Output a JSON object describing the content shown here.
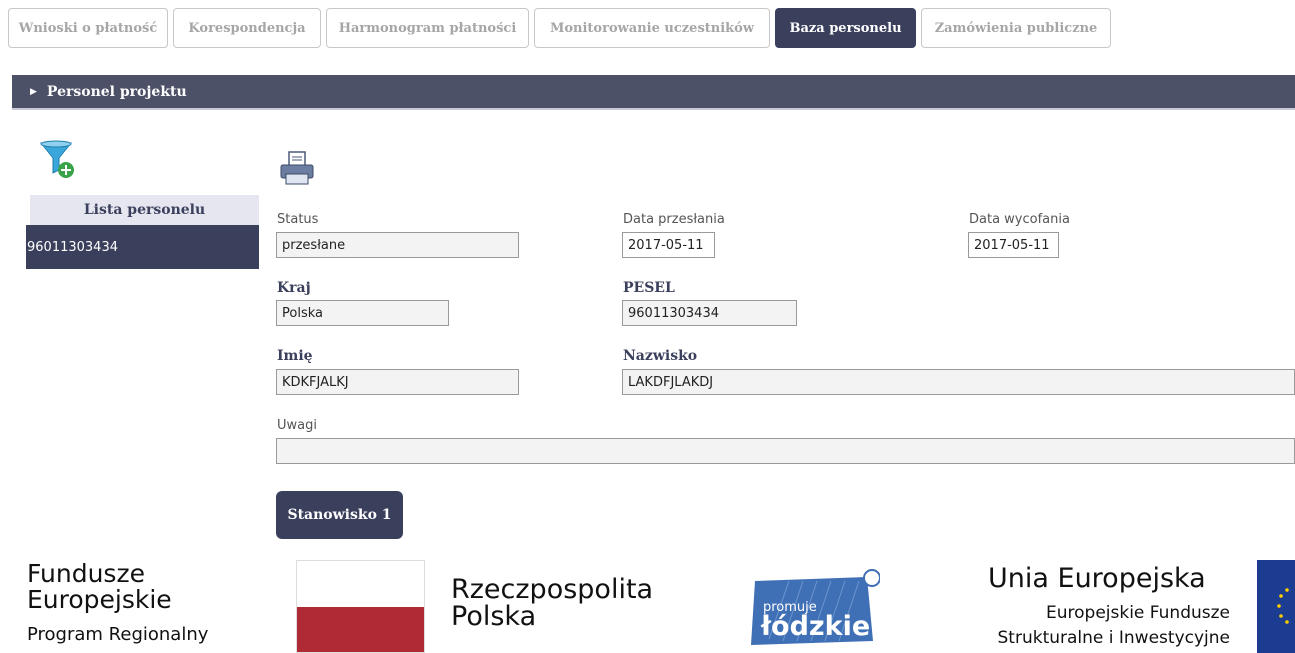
{
  "tabs": [
    {
      "label": "Wnioski o płatność",
      "active": false
    },
    {
      "label": "Korespondencja",
      "active": false
    },
    {
      "label": "Harmonogram płatności",
      "active": false
    },
    {
      "label": "Monitorowanie uczestników",
      "active": false
    },
    {
      "label": "Baza personelu",
      "active": true
    },
    {
      "label": "Zamówienia publiczne",
      "active": false
    }
  ],
  "section": {
    "title": "Personel projektu"
  },
  "sidebar": {
    "list_header": "Lista personelu",
    "items": [
      {
        "label": "96011303434"
      }
    ]
  },
  "form": {
    "status_label": "Status",
    "status_value": "przesłane",
    "data_przeslania_label": "Data przesłania",
    "data_przeslania_value": "2017-05-11",
    "data_wycofania_label": "Data wycofania",
    "data_wycofania_value": "2017-05-11",
    "kraj_label": "Kraj",
    "kraj_value": "Polska",
    "pesel_label": "PESEL",
    "pesel_value": "96011303434",
    "imie_label": "Imię",
    "imie_value": "KDKFJALKJ",
    "nazwisko_label": "Nazwisko",
    "nazwisko_value": "LAKDFJLAKDJ",
    "uwagi_label": "Uwagi",
    "uwagi_value": ""
  },
  "buttons": {
    "stanowisko": "Stanowisko 1"
  },
  "footer": {
    "fe_line1": "Fundusze",
    "fe_line2": "Europejskie",
    "fe_sub": "Program Regionalny",
    "rp_line1": "Rzeczpospolita",
    "rp_line2": "Polska",
    "lodz_small": "promuje",
    "lodz_big": "łódzkie",
    "ue_title": "Unia Europejska",
    "ue_sub1": "Europejskie Fundusze",
    "ue_sub2": "Strukturalne i Inwestycyjne"
  },
  "colors": {
    "primary": "#3a3f5c",
    "section_bar": "#4d5168",
    "flag_red": "#b02a36",
    "eu_blue": "#1b3c91"
  },
  "icons": [
    "filter-add-icon",
    "print-icon",
    "caret-right-icon"
  ]
}
